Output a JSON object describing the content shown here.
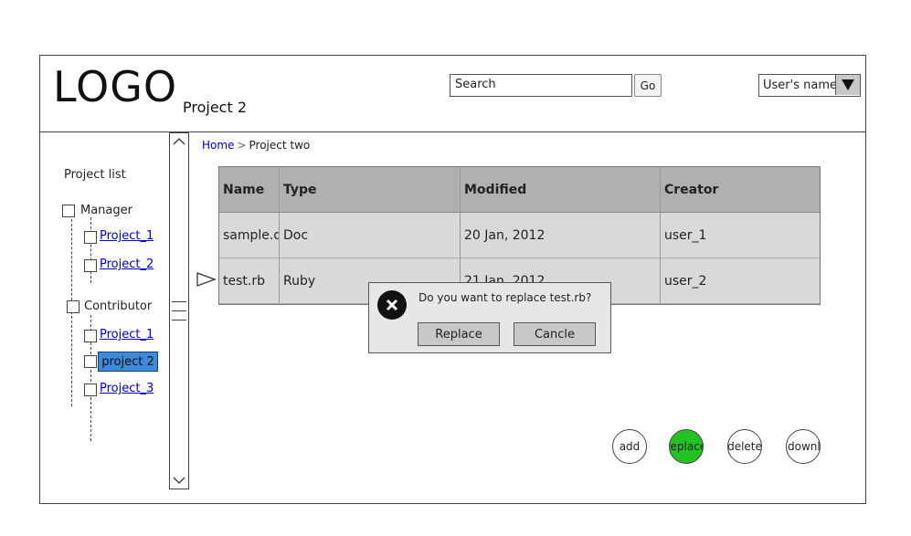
{
  "header": {
    "logo_text": "LOGO",
    "project_title": "Project 2",
    "search": {
      "value": "Search",
      "button_label": "Go"
    },
    "user_menu": {
      "label": "User's name",
      "icon": "triangle-down-icon"
    }
  },
  "sidebar": {
    "title": "Project list",
    "groups": [
      {
        "label": "Manager",
        "items": [
          "Project_1",
          "Project_2"
        ]
      },
      {
        "label": "Contributor",
        "items": [
          "Project_1",
          "project 2",
          "Project_3"
        ]
      }
    ],
    "selected_item": "project 2"
  },
  "breadcrumb": {
    "home": "Home",
    "separator": ">",
    "current": "Project two"
  },
  "table": {
    "columns": [
      "Name",
      "Type",
      "Modified",
      "Creator"
    ],
    "rows": [
      {
        "name": "sample.doc",
        "type": "Doc",
        "modified": "20 Jan, 2012",
        "creator": "user_1"
      },
      {
        "name": "test.rb",
        "type": "Ruby",
        "modified": "21 Jan, 2012",
        "creator": "user_2"
      }
    ]
  },
  "dialog": {
    "icon": "close-circle-icon",
    "message": "Do you want to replace test.rb?",
    "confirm_label": "Replace",
    "cancel_label": "Cancle"
  },
  "actions": {
    "add": "add",
    "replace": "replace",
    "delete": "delete",
    "download": "download"
  },
  "colors": {
    "accent_green": "#22c322",
    "selected_blue": "#3d8ad8",
    "link_blue": "#0000cc",
    "header_gray": "#b0b0b0",
    "row_gray": "#d9d9d9"
  }
}
